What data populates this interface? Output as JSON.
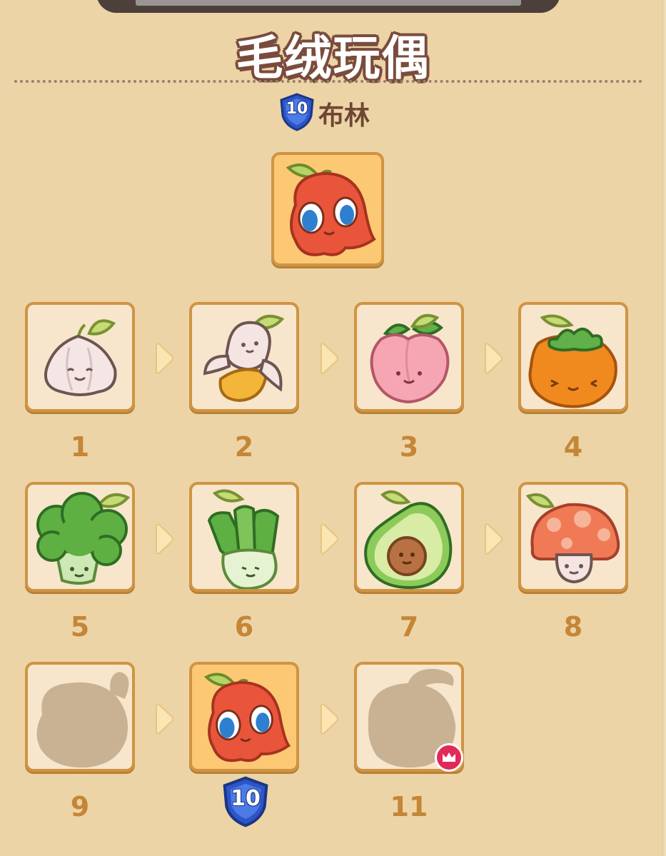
{
  "header": {
    "title": "毛绒玩偶",
    "character_level": "10",
    "character_name": "布林"
  },
  "featured": {
    "name": "red-apple-sprout-plush",
    "selected": true
  },
  "stages": [
    {
      "number": "1",
      "name": "garlic-plush",
      "unlocked": true
    },
    {
      "number": "2",
      "name": "banana-plush",
      "unlocked": true
    },
    {
      "number": "3",
      "name": "peach-plush",
      "unlocked": true
    },
    {
      "number": "4",
      "name": "persimmon-plush",
      "unlocked": true
    },
    {
      "number": "5",
      "name": "broccoli-plush",
      "unlocked": true
    },
    {
      "number": "6",
      "name": "leek-plush",
      "unlocked": true
    },
    {
      "number": "7",
      "name": "avocado-plush",
      "unlocked": true
    },
    {
      "number": "8",
      "name": "mushroom-plush",
      "unlocked": true
    },
    {
      "number": "9",
      "name": "locked-silhouette",
      "unlocked": false
    },
    {
      "number": "10",
      "name": "red-apple-sprout-plush",
      "unlocked": true,
      "selected": true,
      "level_badge": "10"
    },
    {
      "number": "11",
      "name": "locked-silhouette-crown",
      "unlocked": false,
      "crown": true
    }
  ],
  "colors": {
    "background": "#ecd4a6",
    "card_border": "#cf9443",
    "card_fill": "#f7e6cb",
    "selected_fill": "#fcc873",
    "number_text": "#c48637",
    "title_outline": "#7a4b3c",
    "shield_blue": "#2d55c8",
    "crown_badge": "#e22a58"
  }
}
